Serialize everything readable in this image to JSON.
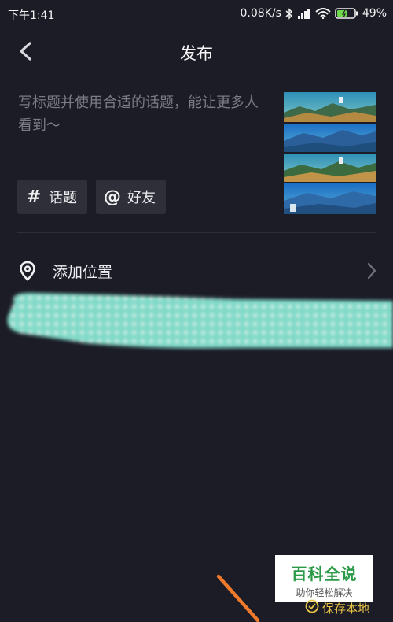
{
  "status_bar": {
    "time": "下午1:41",
    "network_speed": "0.08K/s",
    "battery": "49%",
    "icons": [
      "bluetooth-icon",
      "signal-icon",
      "wifi-icon",
      "battery-icon"
    ]
  },
  "nav": {
    "title": "发布",
    "back_icon": "chevron-left-icon"
  },
  "composer": {
    "placeholder": "写标题并使用合适的话题，能让更多人看到～",
    "topic_icon": "#",
    "topic_label": "话题",
    "friend_icon": "@",
    "friend_label": "好友"
  },
  "location": {
    "label": "添加位置",
    "icon": "location-pin-icon"
  },
  "watermark": {
    "title": "百科全说",
    "subtitle": "助你轻松解决"
  },
  "bottom": {
    "save_label": "保存本地"
  },
  "colors": {
    "background": "#1b1c26",
    "chip": "#2e2f39",
    "accent_save": "#e8c445",
    "stripe": "#8fe0d0",
    "arrow": "#f07a2c"
  }
}
